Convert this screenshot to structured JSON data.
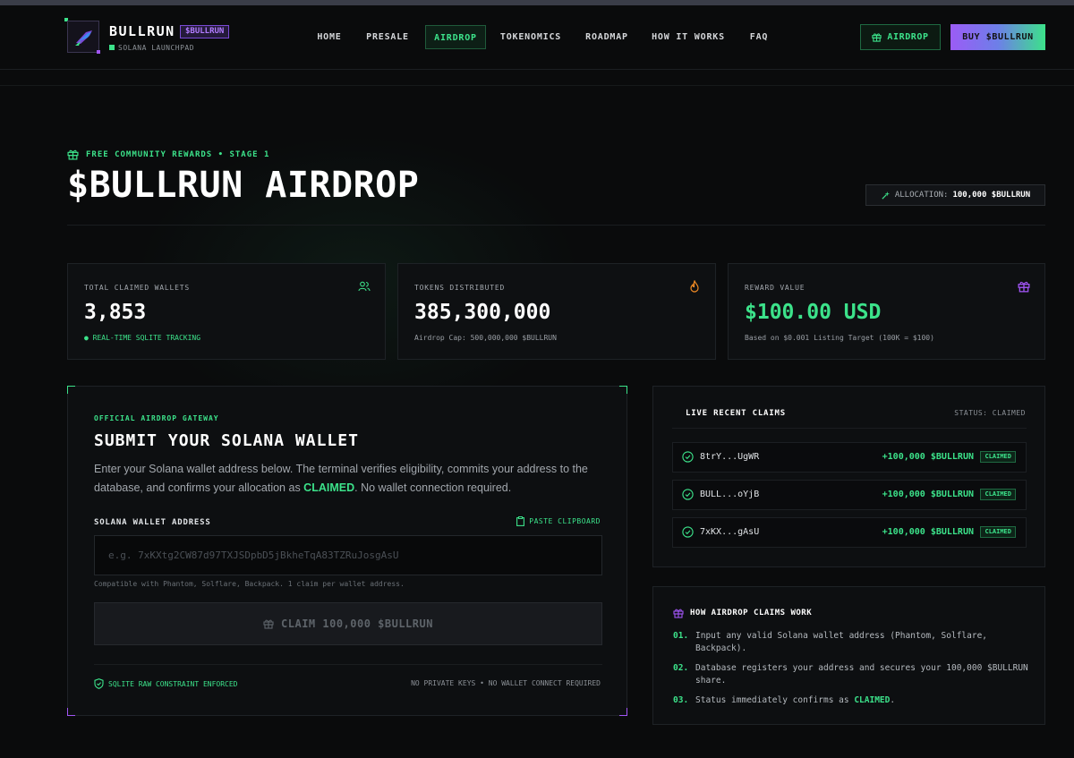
{
  "header": {
    "brand": "BULLRUN",
    "ticker": "$BULLRUN",
    "subtitle": "SOLANA LAUNCHPAD",
    "nav": [
      "HOME",
      "PRESALE",
      "AIRDROP",
      "TOKENOMICS",
      "ROADMAP",
      "HOW IT WORKS",
      "FAQ"
    ],
    "active_nav": "AIRDROP",
    "airdrop_button": "AIRDROP",
    "buy_button": "BUY $BULLRUN"
  },
  "hero": {
    "eyebrow": "FREE COMMUNITY REWARDS • STAGE 1",
    "title": "$BULLRUN AIRDROP",
    "allocation_label": "ALLOCATION:",
    "allocation_value": "100,000 $BULLRUN"
  },
  "stats": [
    {
      "label": "TOTAL CLAIMED WALLETS",
      "value": "3,853",
      "sub": "● REAL-TIME SQLITE TRACKING",
      "icon": "users-icon"
    },
    {
      "label": "TOKENS DISTRIBUTED",
      "value": "385,300,000",
      "sub": "Airdrop Cap: 500,000,000 $BULLRUN",
      "icon": "flame-icon"
    },
    {
      "label": "REWARD VALUE",
      "value": "$100.00 USD",
      "sub": "Based on $0.001 Listing Target (100K = $100)",
      "icon": "gift-icon"
    }
  ],
  "gateway": {
    "eyebrow": "OFFICIAL AIRDROP GATEWAY",
    "title": "SUBMIT YOUR SOLANA WALLET",
    "desc_before": "Enter your Solana wallet address below. The terminal verifies eligibility, commits your address to the database, and confirms your allocation as ",
    "desc_highlight": "CLAIMED",
    "desc_after": ". No wallet connection required.",
    "field_label": "SOLANA WALLET ADDRESS",
    "paste_label": "PASTE CLIPBOARD",
    "placeholder": "e.g. 7xKXtg2CW87d97TXJSDpbD5jBkheTqA83TZRuJosgAsU",
    "value": "",
    "hint": "Compatible with Phantom, Solflare, Backpack. 1 claim per wallet address.",
    "claim_button": "CLAIM 100,000 $BULLRUN",
    "footer_left": "SQLITE RAW CONSTRAINT ENFORCED",
    "footer_right": "NO PRIVATE KEYS • NO WALLET CONNECT REQUIRED"
  },
  "live": {
    "title": "LIVE RECENT CLAIMS",
    "status": "STATUS: CLAIMED",
    "claims": [
      {
        "address": "8trY...UgWR",
        "amount": "+100,000 $BULLRUN",
        "tag": "CLAIMED"
      },
      {
        "address": "BULL...oYjB",
        "amount": "+100,000 $BULLRUN",
        "tag": "CLAIMED"
      },
      {
        "address": "7xKX...gAsU",
        "amount": "+100,000 $BULLRUN",
        "tag": "CLAIMED"
      }
    ]
  },
  "how": {
    "title": "HOW AIRDROP CLAIMS WORK",
    "steps": [
      {
        "num": "01.",
        "text": "Input any valid Solana wallet address (Phantom, Solflare, Backpack)."
      },
      {
        "num": "02.",
        "text": "Database registers your address and secures your 100,000 $BULLRUN share."
      },
      {
        "num": "03.",
        "text_before": "Status immediately confirms as ",
        "highlight": "CLAIMED",
        "text_after": "."
      }
    ]
  },
  "colors": {
    "accent": "#3ce28a",
    "purple": "#a155f5",
    "background": "#0a0b0c"
  }
}
